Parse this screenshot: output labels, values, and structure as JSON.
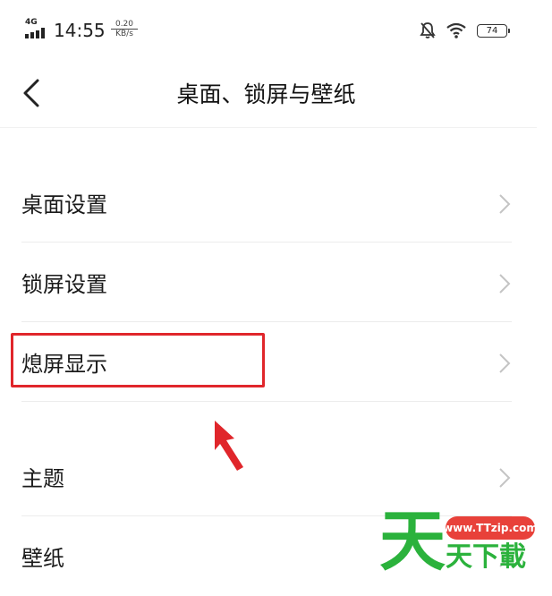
{
  "status_bar": {
    "network": "4G",
    "time": "14:55",
    "speed_value": "0.20",
    "speed_unit": "KB/s",
    "battery": "74"
  },
  "header": {
    "title": "桌面、锁屏与壁纸"
  },
  "menu": {
    "items": [
      {
        "label": "桌面设置"
      },
      {
        "label": "锁屏设置"
      },
      {
        "label": "熄屏显示"
      },
      {
        "label": "主题"
      },
      {
        "label": "壁纸"
      }
    ]
  },
  "watermark": {
    "url": "www.TTzip.com",
    "big_char": "天",
    "text": "天下載"
  },
  "colors": {
    "highlight": "#e0262b",
    "watermark_green": "#2bb23c",
    "watermark_red": "#e8413a"
  }
}
